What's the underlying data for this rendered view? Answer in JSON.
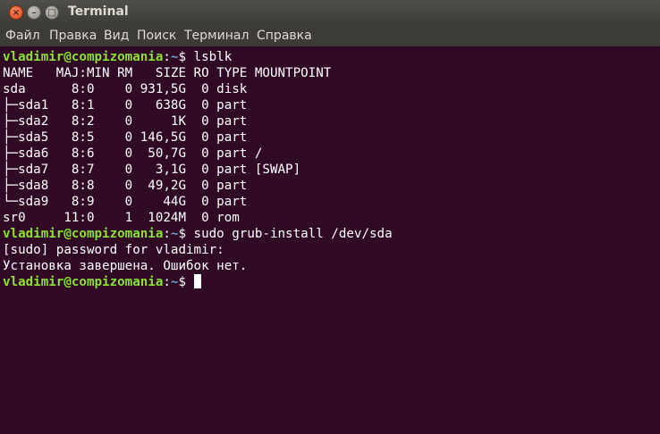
{
  "window": {
    "title": "Terminal",
    "close_glyph": "×",
    "min_glyph": "–",
    "max_glyph": "□"
  },
  "menu": [
    "Файл",
    "Правка",
    "Вид",
    "Поиск",
    "Терминал",
    "Справка"
  ],
  "prompt": {
    "user_host": "vladimir@compizomania",
    "separator": ":",
    "path": "~",
    "symbol": "$"
  },
  "terminal": {
    "cmd1": " lsblk",
    "lsblk": [
      "NAME   MAJ:MIN RM   SIZE RO TYPE MOUNTPOINT",
      "sda      8:0    0 931,5G  0 disk",
      "├─sda1   8:1    0   638G  0 part",
      "├─sda2   8:2    0     1K  0 part",
      "├─sda5   8:5    0 146,5G  0 part",
      "├─sda6   8:6    0  50,7G  0 part /",
      "├─sda7   8:7    0   3,1G  0 part [SWAP]",
      "├─sda8   8:8    0  49,2G  0 part",
      "└─sda9   8:9    0    44G  0 part",
      "sr0     11:0    1  1024M  0 rom"
    ],
    "cmd2": " sudo grub-install /dev/sda",
    "sudo_prompt": "[sudo] password for vladimir:",
    "result": "Установка завершена. Ошибок нет.",
    "cmd3": " "
  },
  "colors": {
    "terminal_bg": "#300a24",
    "prompt_user": "#8ae234",
    "prompt_path": "#729fcf",
    "text": "#ffffff",
    "chrome": "#3c3b37"
  }
}
